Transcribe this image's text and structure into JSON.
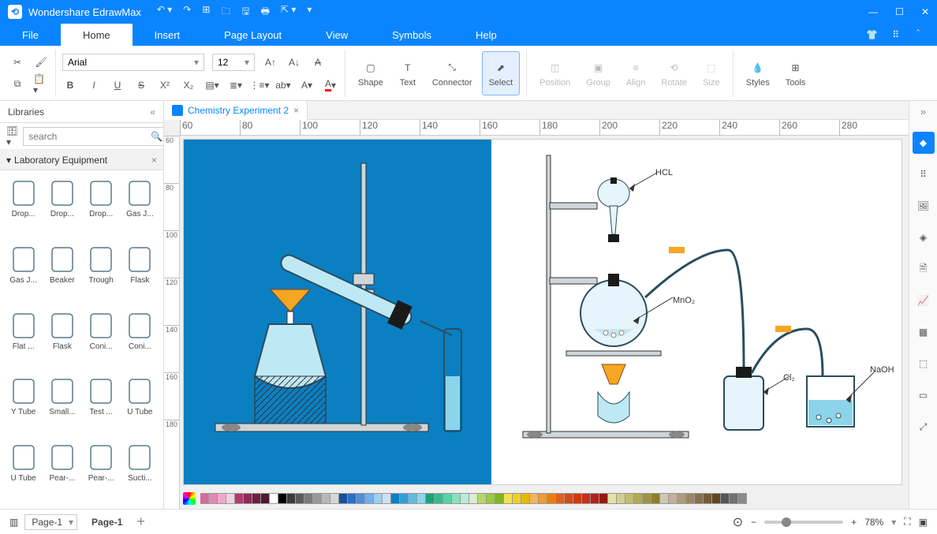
{
  "app": {
    "title": "Wondershare EdrawMax"
  },
  "menus": [
    "File",
    "Home",
    "Insert",
    "Page Layout",
    "View",
    "Symbols",
    "Help"
  ],
  "active_menu": 1,
  "ribbon": {
    "font_name": "Arial",
    "font_size": "12",
    "big_buttons": [
      {
        "label": "Shape",
        "name": "shape"
      },
      {
        "label": "Text",
        "name": "text"
      },
      {
        "label": "Connector",
        "name": "connector"
      },
      {
        "label": "Select",
        "name": "select",
        "selected": true
      },
      {
        "label": "Position",
        "name": "position",
        "disabled": true
      },
      {
        "label": "Group",
        "name": "group",
        "disabled": true
      },
      {
        "label": "Align",
        "name": "align",
        "disabled": true
      },
      {
        "label": "Rotate",
        "name": "rotate",
        "disabled": true
      },
      {
        "label": "Size",
        "name": "size",
        "disabled": true
      },
      {
        "label": "Styles",
        "name": "styles"
      },
      {
        "label": "Tools",
        "name": "tools"
      }
    ]
  },
  "libraries": {
    "title": "Libraries",
    "search_placeholder": "search",
    "category": "Laboratory Equipment",
    "items": [
      {
        "label": "Drop..."
      },
      {
        "label": "Drop..."
      },
      {
        "label": "Drop..."
      },
      {
        "label": "Gas J..."
      },
      {
        "label": "Gas J..."
      },
      {
        "label": "Beaker"
      },
      {
        "label": "Trough"
      },
      {
        "label": "Flask"
      },
      {
        "label": "Flat ..."
      },
      {
        "label": "Flask"
      },
      {
        "label": "Coni..."
      },
      {
        "label": "Coni..."
      },
      {
        "label": "Y Tube"
      },
      {
        "label": "Small..."
      },
      {
        "label": "Test ..."
      },
      {
        "label": "U Tube"
      },
      {
        "label": "U Tube"
      },
      {
        "label": "Pear-..."
      },
      {
        "label": "Pear-..."
      },
      {
        "label": "Sucti..."
      }
    ]
  },
  "document": {
    "tab_name": "Chemistry Experiment 2"
  },
  "canvas_labels": {
    "hcl": "HCL",
    "mno2": "MnO₂",
    "cl2": "Cl₂",
    "naoh": "NaOH"
  },
  "ruler_h": [
    "60",
    "80",
    "100",
    "120",
    "140",
    "160",
    "180",
    "200",
    "220",
    "240",
    "260",
    "280"
  ],
  "ruler_v": [
    "60",
    "80",
    "100",
    "120",
    "140",
    "160",
    "180"
  ],
  "status": {
    "page_select": "Page-1",
    "page_tab": "Page-1",
    "zoom": "78%"
  },
  "color_swatches": [
    "#d36a9e",
    "#e388b5",
    "#ecabce",
    "#f4cfe4",
    "#b23a6f",
    "#8c2c57",
    "#6c213f",
    "#4f1830",
    "#ffffff",
    "#000000",
    "#3b3b3b",
    "#5b5b5b",
    "#7a7a7a",
    "#999999",
    "#b8b8b8",
    "#d6d6d6",
    "#1b4f9b",
    "#2c6fc9",
    "#4a8fe0",
    "#74aeea",
    "#a0cdee",
    "#c9e3f6",
    "#0a7fc2",
    "#2ea0d6",
    "#5bbce4",
    "#8cd4ed",
    "#1aa276",
    "#2dc08e",
    "#55d3a6",
    "#88e1c0",
    "#b8ecd8",
    "#deebd0",
    "#b5d66a",
    "#9acb3c",
    "#7eb523",
    "#f5e04a",
    "#f3cf1f",
    "#e6b800",
    "#f4b25a",
    "#f29b2e",
    "#ea7e10",
    "#e3601b",
    "#da4a12",
    "#cf3a0f",
    "#c92f19",
    "#b02014",
    "#951a11",
    "#e6e2a8",
    "#d4cf8c",
    "#c2bb70",
    "#b0a856",
    "#9e9440",
    "#8c802b",
    "#d3c7b2",
    "#c0b198",
    "#ad9b7e",
    "#9a8665",
    "#87704c",
    "#745a34",
    "#614520",
    "#555555",
    "#707070",
    "#8b8b8b"
  ]
}
